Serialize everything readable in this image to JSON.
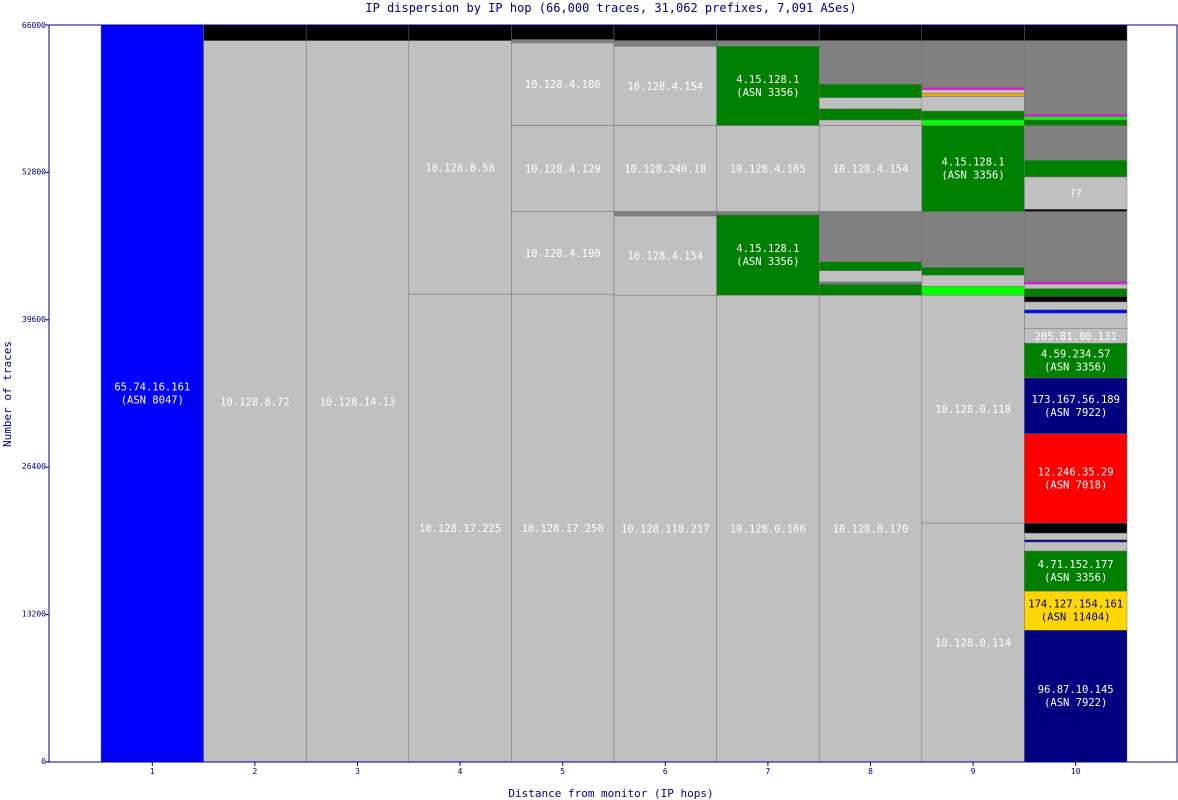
{
  "chart_data": {
    "type": "stacked-bar",
    "title": "IP dispersion by IP hop (66,000 traces, 31,062 prefixes, 7,091 ASes)",
    "xlabel": "Distance from monitor (IP hops)",
    "ylabel": "Number of traces",
    "ylim": [
      0,
      66000
    ],
    "yticks": [
      0,
      13200,
      26400,
      39600,
      52800,
      66000
    ],
    "xticks": [
      1,
      2,
      3,
      4,
      5,
      6,
      7,
      8,
      9,
      10
    ],
    "grid": false,
    "legend": "none",
    "colors": {
      "gray": "#c0c0c0",
      "dark_gray": "#808080",
      "black": "#000000",
      "blue": "#0000ff",
      "navy": "#000080",
      "green": "#008000",
      "lime": "#00ff00",
      "red": "#ff0000",
      "gold": "#ffd700",
      "magenta": "#ff00ff",
      "orange": "#ffa500",
      "axis": "#00008b",
      "label": "#ffffff",
      "label_dark": "#000080"
    },
    "bars": [
      {
        "hop": 1,
        "segments": [
          {
            "y0": 0,
            "y1": 66000,
            "color": "blue",
            "label": "65.74.16.161",
            "sub": "(ASN 8047)"
          }
        ]
      },
      {
        "hop": 2,
        "segments": [
          {
            "y0": 0,
            "y1": 64600,
            "color": "gray",
            "label": "10.128.8.72"
          },
          {
            "y0": 64600,
            "y1": 66000,
            "color": "black"
          }
        ]
      },
      {
        "hop": 3,
        "segments": [
          {
            "y0": 0,
            "y1": 64600,
            "color": "gray",
            "label": "10.128.14.13"
          },
          {
            "y0": 64600,
            "y1": 66000,
            "color": "black"
          }
        ]
      },
      {
        "hop": 4,
        "segments": [
          {
            "y0": 0,
            "y1": 41900,
            "color": "gray",
            "label": "10.128.17.225"
          },
          {
            "y0": 41900,
            "y1": 64600,
            "color": "gray",
            "label": "10.128.8.58"
          },
          {
            "y0": 64600,
            "y1": 66000,
            "color": "black"
          }
        ]
      },
      {
        "hop": 5,
        "segments": [
          {
            "y0": 0,
            "y1": 41900,
            "color": "gray",
            "label": "10.128.17.250"
          },
          {
            "y0": 41900,
            "y1": 49300,
            "color": "gray",
            "label": "10.128.4.190"
          },
          {
            "y0": 49300,
            "y1": 57000,
            "color": "gray",
            "label": "10.128.4.129"
          },
          {
            "y0": 57000,
            "y1": 64400,
            "color": "gray",
            "label": "10.128.4.186"
          },
          {
            "y0": 64400,
            "y1": 64700,
            "color": "dark_gray"
          },
          {
            "y0": 64700,
            "y1": 66000,
            "color": "black"
          }
        ]
      },
      {
        "hop": 6,
        "segments": [
          {
            "y0": 0,
            "y1": 41800,
            "color": "gray",
            "label": "10.128.118.217"
          },
          {
            "y0": 41800,
            "y1": 48900,
            "color": "gray",
            "label": "10.128.4.154"
          },
          {
            "y0": 48900,
            "y1": 49300,
            "color": "dark_gray"
          },
          {
            "y0": 49300,
            "y1": 57000,
            "color": "gray",
            "label": "10.128.240.18"
          },
          {
            "y0": 57000,
            "y1": 64100,
            "color": "gray",
            "label": "10.128.4.154"
          },
          {
            "y0": 64100,
            "y1": 64600,
            "color": "dark_gray"
          },
          {
            "y0": 64600,
            "y1": 66000,
            "color": "black"
          }
        ]
      },
      {
        "hop": 7,
        "segments": [
          {
            "y0": 0,
            "y1": 41800,
            "color": "gray",
            "label": "10.128.0.166"
          },
          {
            "y0": 41800,
            "y1": 49000,
            "color": "green",
            "label": "4.15.128.1",
            "sub": "(ASN 3356)"
          },
          {
            "y0": 49000,
            "y1": 49300,
            "color": "dark_gray"
          },
          {
            "y0": 49300,
            "y1": 57000,
            "color": "gray",
            "label": "10.128.4.165"
          },
          {
            "y0": 57000,
            "y1": 64100,
            "color": "green",
            "label": "4.15.128.1",
            "sub": "(ASN 3356)"
          },
          {
            "y0": 64100,
            "y1": 64600,
            "color": "dark_gray"
          },
          {
            "y0": 64600,
            "y1": 66000,
            "color": "black"
          }
        ]
      },
      {
        "hop": 8,
        "segments": [
          {
            "y0": 0,
            "y1": 41800,
            "color": "gray",
            "label": "10.128.0.170"
          },
          {
            "y0": 41800,
            "y1": 42800,
            "color": "green"
          },
          {
            "y0": 42800,
            "y1": 43000,
            "color": "dark_gray"
          },
          {
            "y0": 43000,
            "y1": 44000,
            "color": "gray"
          },
          {
            "y0": 44000,
            "y1": 44800,
            "color": "green"
          },
          {
            "y0": 44800,
            "y1": 49300,
            "color": "dark_gray"
          },
          {
            "y0": 49300,
            "y1": 57000,
            "color": "gray",
            "label": "10.128.4.154"
          },
          {
            "y0": 57000,
            "y1": 57500,
            "color": "gray"
          },
          {
            "y0": 57500,
            "y1": 58500,
            "color": "green"
          },
          {
            "y0": 58500,
            "y1": 59500,
            "color": "gray"
          },
          {
            "y0": 59500,
            "y1": 60700,
            "color": "green"
          },
          {
            "y0": 60700,
            "y1": 64600,
            "color": "dark_gray"
          },
          {
            "y0": 64600,
            "y1": 66000,
            "color": "black"
          }
        ]
      },
      {
        "hop": 9,
        "segments": [
          {
            "y0": 0,
            "y1": 21400,
            "color": "gray",
            "label": "10.128.0.114"
          },
          {
            "y0": 21400,
            "y1": 41800,
            "color": "gray",
            "label": "10.128.0.118"
          },
          {
            "y0": 41800,
            "y1": 42600,
            "color": "lime"
          },
          {
            "y0": 42600,
            "y1": 43600,
            "color": "gray"
          },
          {
            "y0": 43600,
            "y1": 44300,
            "color": "green"
          },
          {
            "y0": 44300,
            "y1": 49300,
            "color": "dark_gray"
          },
          {
            "y0": 49300,
            "y1": 57000,
            "color": "green",
            "label": "4.15.128.1",
            "sub": "(ASN 3356)"
          },
          {
            "y0": 57000,
            "y1": 57500,
            "color": "lime"
          },
          {
            "y0": 57500,
            "y1": 58300,
            "color": "green"
          },
          {
            "y0": 58300,
            "y1": 59600,
            "color": "gray"
          },
          {
            "y0": 59600,
            "y1": 59900,
            "color": "orange"
          },
          {
            "y0": 59900,
            "y1": 60200,
            "color": "gray"
          },
          {
            "y0": 60200,
            "y1": 60400,
            "color": "magenta"
          },
          {
            "y0": 60400,
            "y1": 64600,
            "color": "dark_gray"
          },
          {
            "y0": 64600,
            "y1": 66000,
            "color": "black"
          }
        ]
      },
      {
        "hop": 10,
        "segments": [
          {
            "y0": 0,
            "y1": 11800,
            "color": "navy",
            "label": "96.87.10.145",
            "sub": "(ASN 7922)"
          },
          {
            "y0": 11800,
            "y1": 15300,
            "color": "gold",
            "label": "174.127.154.161",
            "sub": "(ASN 11404)",
            "dark": true
          },
          {
            "y0": 15300,
            "y1": 18900,
            "color": "green",
            "label": "4.71.152.177",
            "sub": "(ASN 3356)"
          },
          {
            "y0": 18900,
            "y1": 19700,
            "color": "gray"
          },
          {
            "y0": 19700,
            "y1": 19900,
            "color": "navy"
          },
          {
            "y0": 19900,
            "y1": 20500,
            "color": "gray"
          },
          {
            "y0": 20500,
            "y1": 21400,
            "color": "black"
          },
          {
            "y0": 21400,
            "y1": 29400,
            "color": "red",
            "label": "12.246.35.29",
            "sub": "(ASN 7018)"
          },
          {
            "y0": 29400,
            "y1": 34400,
            "color": "navy",
            "label": "173.167.56.189",
            "sub": "(ASN 7922)"
          },
          {
            "y0": 34400,
            "y1": 37500,
            "color": "green",
            "label": "4.59.234.57",
            "sub": "(ASN 3356)"
          },
          {
            "y0": 37500,
            "y1": 38800,
            "color": "gray",
            "label": "205.81.80.131"
          },
          {
            "y0": 38800,
            "y1": 40200,
            "color": "gray"
          },
          {
            "y0": 40200,
            "y1": 40500,
            "color": "blue"
          },
          {
            "y0": 40500,
            "y1": 41200,
            "color": "gray"
          },
          {
            "y0": 41200,
            "y1": 41700,
            "color": "black"
          },
          {
            "y0": 41700,
            "y1": 42400,
            "color": "green"
          },
          {
            "y0": 42400,
            "y1": 42800,
            "color": "gray"
          },
          {
            "y0": 42800,
            "y1": 43000,
            "color": "magenta"
          },
          {
            "y0": 43000,
            "y1": 49300,
            "color": "dark_gray"
          },
          {
            "y0": 49300,
            "y1": 49500,
            "color": "black"
          },
          {
            "y0": 49500,
            "y1": 52400,
            "color": "gray",
            "label": "??"
          },
          {
            "y0": 52400,
            "y1": 53900,
            "color": "green"
          },
          {
            "y0": 53900,
            "y1": 57000,
            "color": "dark_gray"
          },
          {
            "y0": 57000,
            "y1": 57500,
            "color": "green"
          },
          {
            "y0": 57500,
            "y1": 57800,
            "color": "lime"
          },
          {
            "y0": 57800,
            "y1": 58000,
            "color": "magenta"
          },
          {
            "y0": 58000,
            "y1": 64600,
            "color": "dark_gray"
          },
          {
            "y0": 64600,
            "y1": 66000,
            "color": "black"
          }
        ]
      }
    ]
  }
}
